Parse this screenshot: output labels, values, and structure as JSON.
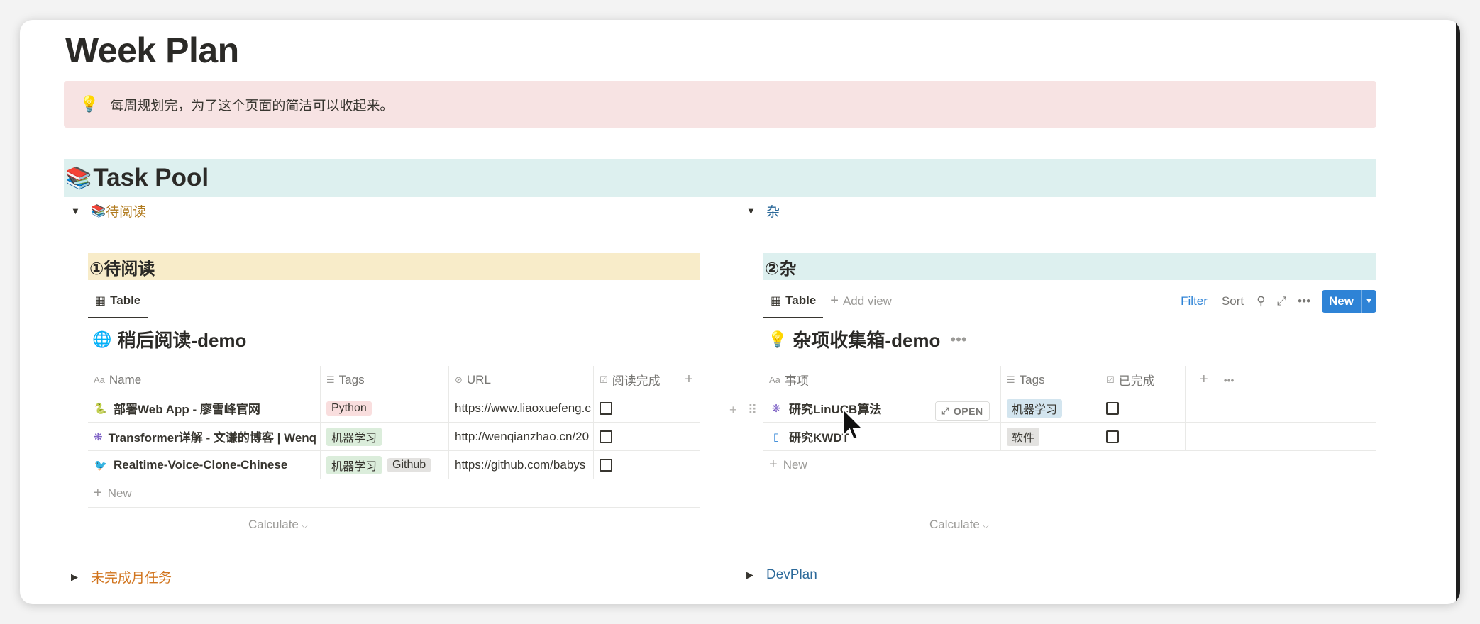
{
  "page": {
    "title": "Week Plan",
    "callout": "每周规划完，为了这个页面的简洁可以收起来。",
    "callout_icon": "lightbulb-icon",
    "section_heading": "Task Pool",
    "section_icon": "books-icon"
  },
  "left": {
    "toggle_label": "待阅读",
    "toggle_icon": "books-icon",
    "sub_heading": "①待阅读",
    "view_tab": "Table",
    "db_title": "稍后阅读-demo",
    "db_icon": "globe-icon",
    "columns": [
      "Name",
      "Tags",
      "URL",
      "阅读完成"
    ],
    "rows": [
      {
        "name": "部署Web App - 廖雪峰官网",
        "icon": "python-icon",
        "tags": [
          "Python"
        ],
        "url": "https://www.liaoxuefeng.c",
        "done": false
      },
      {
        "name": "Transformer详解 - 文谦的博客 | Wenq",
        "icon": "network-icon",
        "tags": [
          "机器学习"
        ],
        "url": "http://wenqianzhao.cn/20",
        "done": false
      },
      {
        "name": "Realtime-Voice-Clone-Chinese",
        "icon": "bird-icon",
        "tags": [
          "机器学习",
          "Github"
        ],
        "url": "https://github.com/babys",
        "done": false
      }
    ],
    "new_label": "New",
    "calculate_label": "Calculate",
    "collapsed_toggle": "未完成月任务"
  },
  "right": {
    "toggle_label": "杂",
    "sub_heading": "②杂",
    "view_tab": "Table",
    "add_view": "Add view",
    "toolbar": {
      "filter": "Filter",
      "sort": "Sort",
      "new": "New"
    },
    "db_title": "杂项收集箱-demo",
    "db_icon": "lightbulb-icon",
    "columns": [
      "事项",
      "Tags",
      "已完成"
    ],
    "rows": [
      {
        "name": "研究LinUCB算法",
        "icon": "network-icon",
        "tags": [
          "机器学习"
        ],
        "done": false
      },
      {
        "name": "研究KWDT",
        "icon": "phone-icon",
        "tags": [
          "软件"
        ],
        "done": false
      }
    ],
    "open_label": "OPEN",
    "new_label": "New",
    "calculate_label": "Calculate",
    "collapsed_toggle": "DevPlan"
  },
  "colors": {
    "callout_bg": "#f7e3e3",
    "band_teal": "#ddf0ef",
    "band_yellow": "#f8ecc9",
    "accent_blue": "#2e83d6",
    "tag_python": "#f9dede",
    "tag_ml": "#dbeddb",
    "tag_github": "#e3e2e0",
    "tag_ml_blue": "#d3e5ef",
    "tag_software": "#e3e2e0"
  }
}
